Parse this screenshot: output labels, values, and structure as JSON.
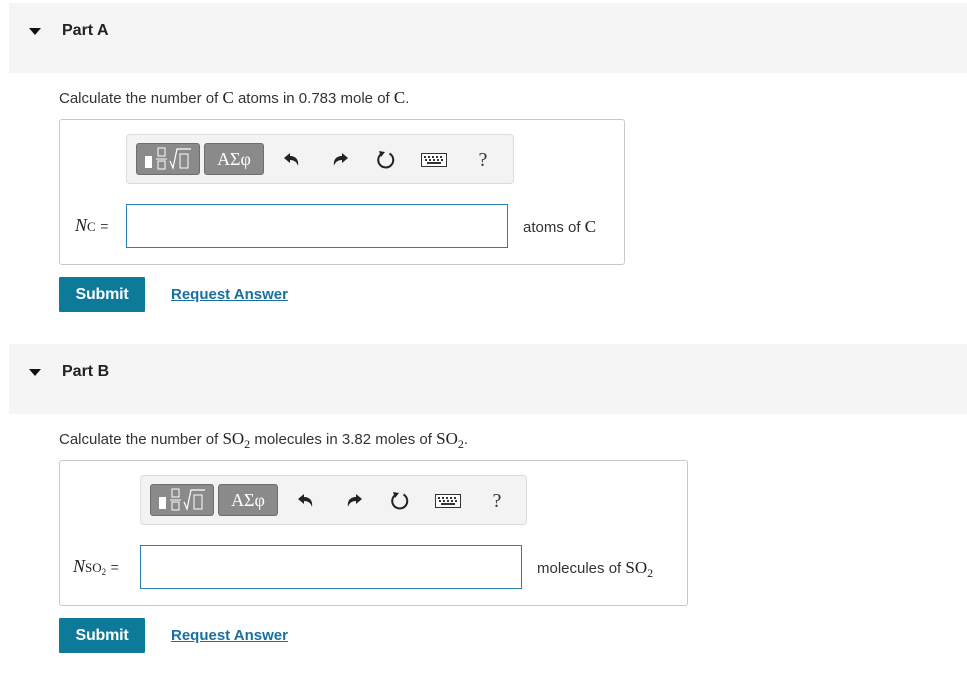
{
  "partA": {
    "title": "Part A",
    "q_prefix": "Calculate the number of ",
    "q_sym1": "C",
    "q_mid": " atoms in 0.783 mole of ",
    "q_sym2": "C",
    "q_end": ".",
    "var_main": "N",
    "var_sub": "C",
    "equals": "=",
    "input_value": "",
    "unit_prefix": "atoms of ",
    "unit_sym": "C",
    "submit_label": "Submit",
    "request_label": "Request Answer"
  },
  "partB": {
    "title": "Part B",
    "q_prefix": "Calculate the number of ",
    "q_sym1": "SO",
    "q_sym1_sub": "2",
    "q_mid": " molecules in 3.82 moles of ",
    "q_sym2": "SO",
    "q_sym2_sub": "2",
    "q_end": ".",
    "var_main": "N",
    "var_sub": "SO",
    "var_subsub": "2",
    "equals": "=",
    "input_value": "",
    "unit_prefix": "molecules of ",
    "unit_sym": "SO",
    "unit_sub": "2",
    "submit_label": "Submit",
    "request_label": "Request Answer"
  },
  "toolbar": {
    "greek_label": "ΑΣφ",
    "help_label": "?",
    "icons": [
      "templates-icon",
      "greek-symbols-icon",
      "undo-icon",
      "redo-icon",
      "reset-icon",
      "keyboard-icon",
      "help-icon"
    ]
  },
  "colors": {
    "accent": "#0e7a9a",
    "link": "#1a6fa1",
    "input_border": "#2b7fb0",
    "header_bg": "#f5f5f5"
  }
}
